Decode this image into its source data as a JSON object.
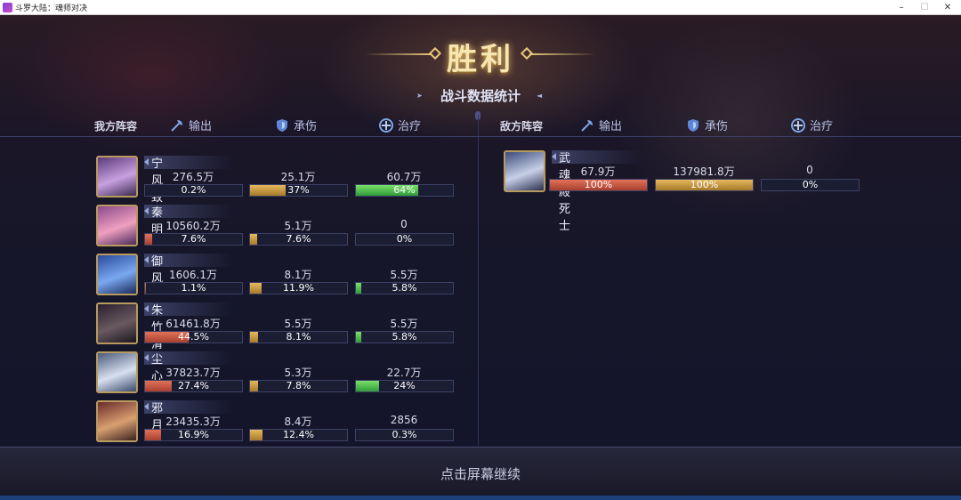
{
  "window": {
    "title": "斗罗大陆：魂师对决",
    "minimize": "–",
    "maximize": "☐",
    "close": "✕"
  },
  "result": {
    "title": "胜利",
    "subtitle": "战斗数据统计"
  },
  "headers": {
    "our_team": "我方阵容",
    "enemy_team": "敌方阵容",
    "damage": "输出",
    "tank": "承伤",
    "heal": "治疗"
  },
  "colors": {
    "damage": "#c9553f",
    "tank": "#c89a44",
    "heal": "#4fc054",
    "gold_accent": "#e6c878"
  },
  "our_team": [
    {
      "name": "宁风致",
      "damage": "276.5万",
      "damage_pct": "0.2%",
      "tank": "25.1万",
      "tank_pct": "37%",
      "heal": "60.7万",
      "heal_pct": "64%"
    },
    {
      "name": "秦明",
      "damage": "10560.2万",
      "damage_pct": "7.6%",
      "tank": "5.1万",
      "tank_pct": "7.6%",
      "heal": "0",
      "heal_pct": "0%"
    },
    {
      "name": "御风",
      "damage": "1606.1万",
      "damage_pct": "1.1%",
      "tank": "8.1万",
      "tank_pct": "11.9%",
      "heal": "5.5万",
      "heal_pct": "5.8%"
    },
    {
      "name": "朱竹清",
      "damage": "61461.8万",
      "damage_pct": "44.5%",
      "tank": "5.5万",
      "tank_pct": "8.1%",
      "heal": "5.5万",
      "heal_pct": "5.8%"
    },
    {
      "name": "尘心",
      "damage": "37823.7万",
      "damage_pct": "27.4%",
      "tank": "5.3万",
      "tank_pct": "7.8%",
      "heal": "22.7万",
      "heal_pct": "24%"
    },
    {
      "name": "邪月",
      "damage": "23435.3万",
      "damage_pct": "16.9%",
      "tank": "8.4万",
      "tank_pct": "12.4%",
      "heal": "2856",
      "heal_pct": "0.3%"
    }
  ],
  "enemy_team": [
    {
      "name": "武魂殿死士",
      "damage": "67.9万",
      "damage_pct": "100%",
      "tank": "137981.8万",
      "tank_pct": "100%",
      "heal": "0",
      "heal_pct": "0%"
    }
  ],
  "footer": {
    "continue": "点击屏幕继续"
  }
}
